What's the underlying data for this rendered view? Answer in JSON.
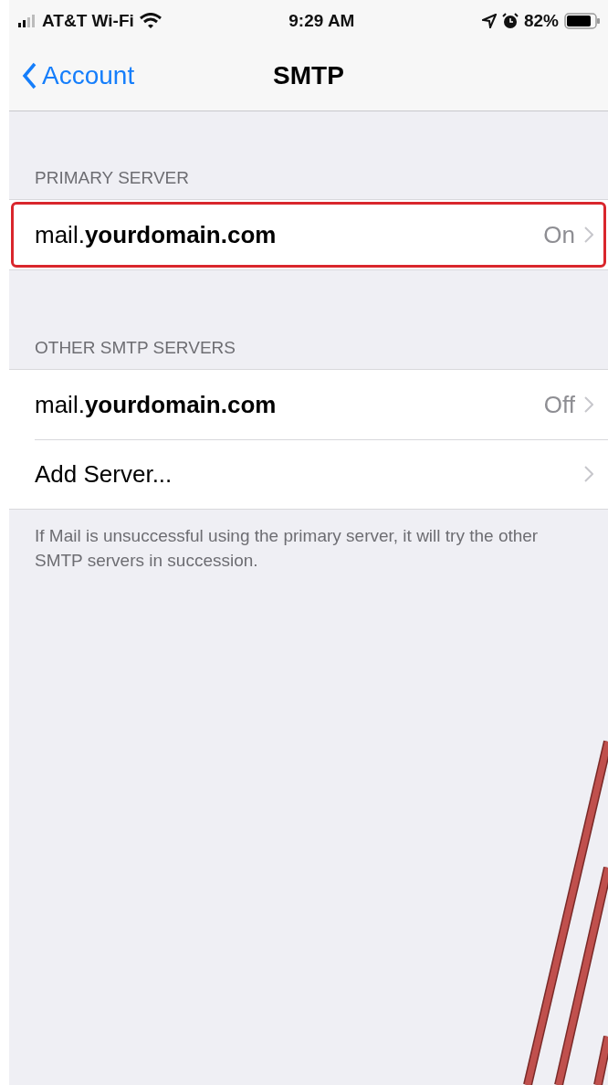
{
  "status_bar": {
    "carrier": "AT&T Wi-Fi",
    "time": "9:29 AM",
    "battery": "82%"
  },
  "nav": {
    "back": "Account",
    "title": "SMTP"
  },
  "sections": [
    {
      "header": "PRIMARY SERVER",
      "rows": [
        {
          "label": "mail.**yourdomain.com**",
          "value": "On",
          "highlighted": true
        }
      ]
    },
    {
      "header": "OTHER SMTP SERVERS",
      "rows": [
        {
          "label": "mail.**yourdomain.com**",
          "value": "Off",
          "highlighted": false
        },
        {
          "label": "Add Server...",
          "highlighted": false
        }
      ]
    }
  ],
  "footer": "If Mail is unsuccessful using the primary server, it will try the other SMTP servers in succession."
}
